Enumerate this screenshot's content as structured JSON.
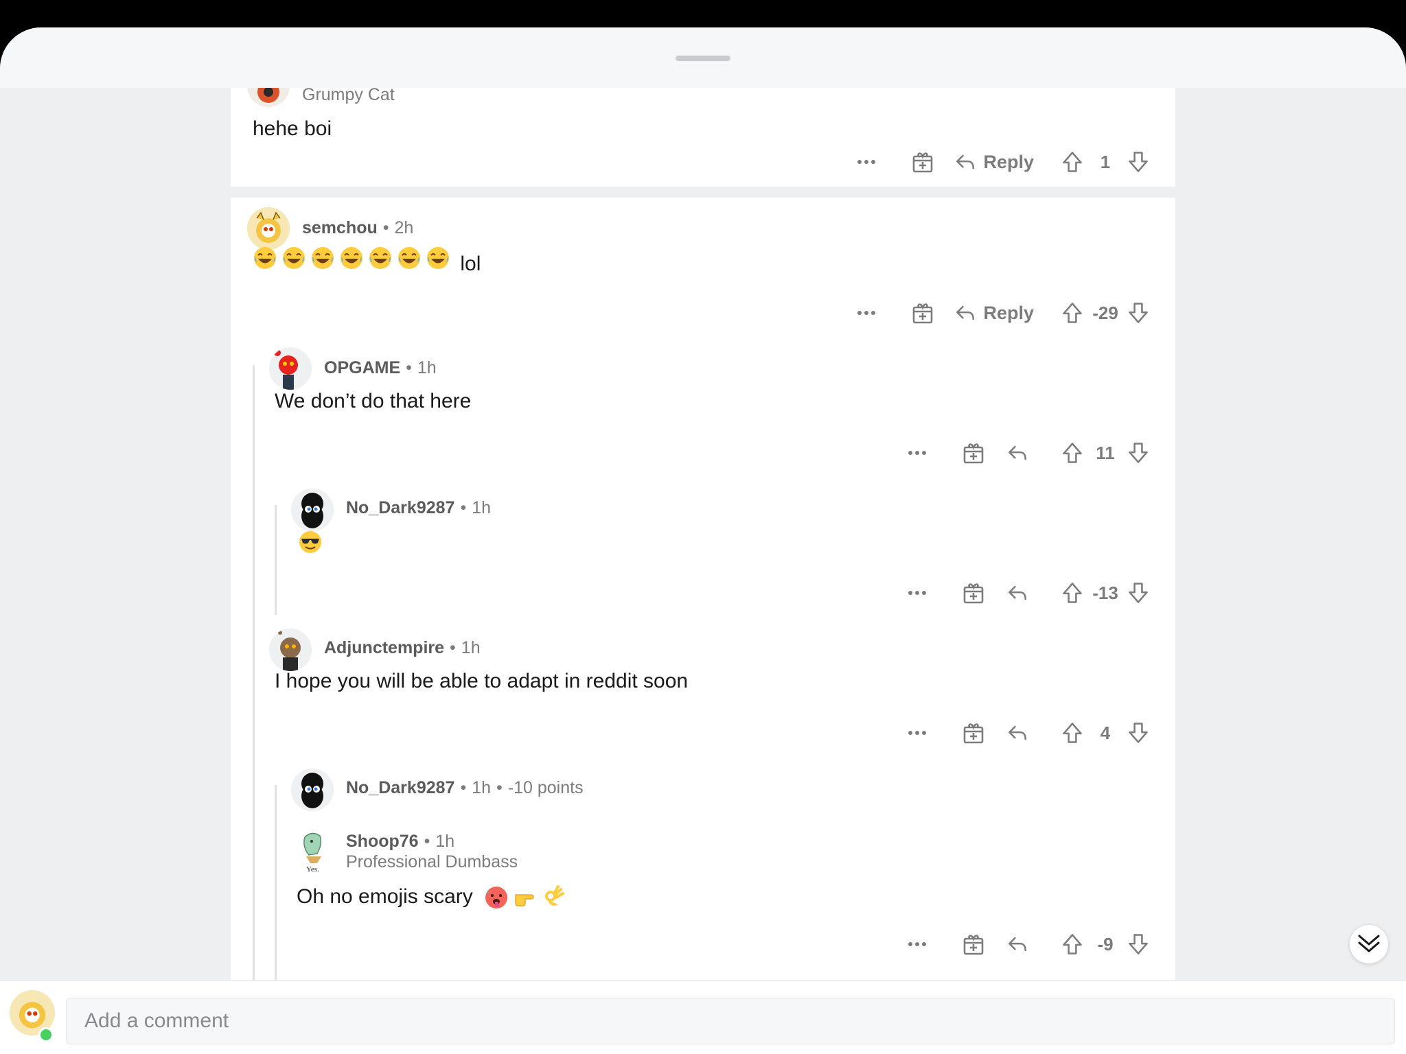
{
  "comments": [
    {
      "flair": "Grumpy Cat",
      "text": "hehe boi",
      "reply_label": "Reply",
      "score": "1"
    },
    {
      "user": "semchou",
      "time": "2h",
      "emoji_count": 7,
      "text_suffix": "lol",
      "reply_label": "Reply",
      "score": "-29"
    },
    {
      "user": "OPGAME",
      "time": "1h",
      "text": "We don’t do that here",
      "score": "11"
    },
    {
      "user": "No_Dark9287",
      "time": "1h",
      "text_emoji": "sunglasses-face",
      "score": "-13"
    },
    {
      "user": "Adjunctempire",
      "time": "1h",
      "text": "I hope you will be able to adapt in reddit soon",
      "score": "4"
    },
    {
      "user": "No_Dark9287",
      "time": "1h",
      "points": "-10 points"
    },
    {
      "user": "Shoop76",
      "time": "1h",
      "flair": "Professional Dumbass",
      "avatar_caption": "Yes.",
      "text": "Oh no emojis scary",
      "score": "-9"
    }
  ],
  "composer": {
    "placeholder": "Add a comment"
  },
  "colors": {
    "accent_online": "#46d160",
    "meta_gray": "#7c7c7c",
    "sheet_bg": "#edeff1"
  }
}
